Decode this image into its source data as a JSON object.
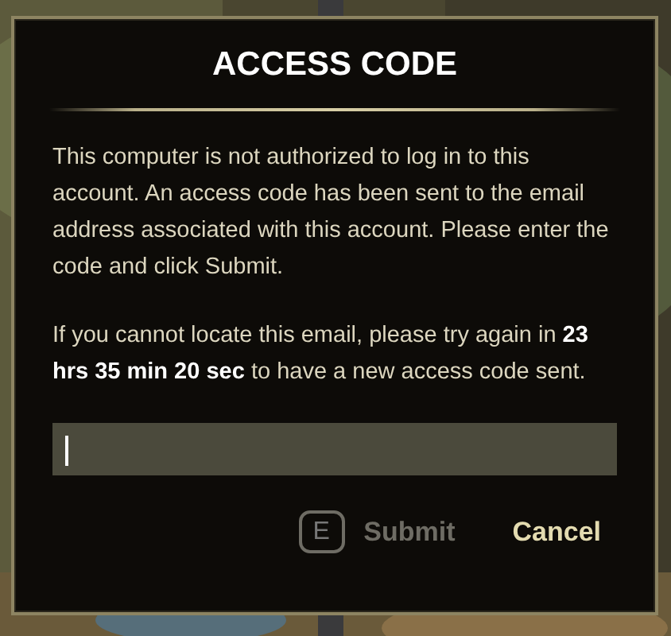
{
  "dialog": {
    "title": "ACCESS CODE",
    "paragraphs": [
      "This computer is not authorized to log in to this account. An access code has been sent to the email address associated with this account. Please enter the code and click Submit.",
      "If you cannot locate this email, please try again in **23 hrs 35 min 20 sec** to have a new access code sent."
    ],
    "input": {
      "focused": true
    },
    "buttons": [
      {
        "label": "Submit",
        "key": "E",
        "disabled": true
      },
      {
        "label": "Cancel",
        "disabled": false
      }
    ]
  }
}
